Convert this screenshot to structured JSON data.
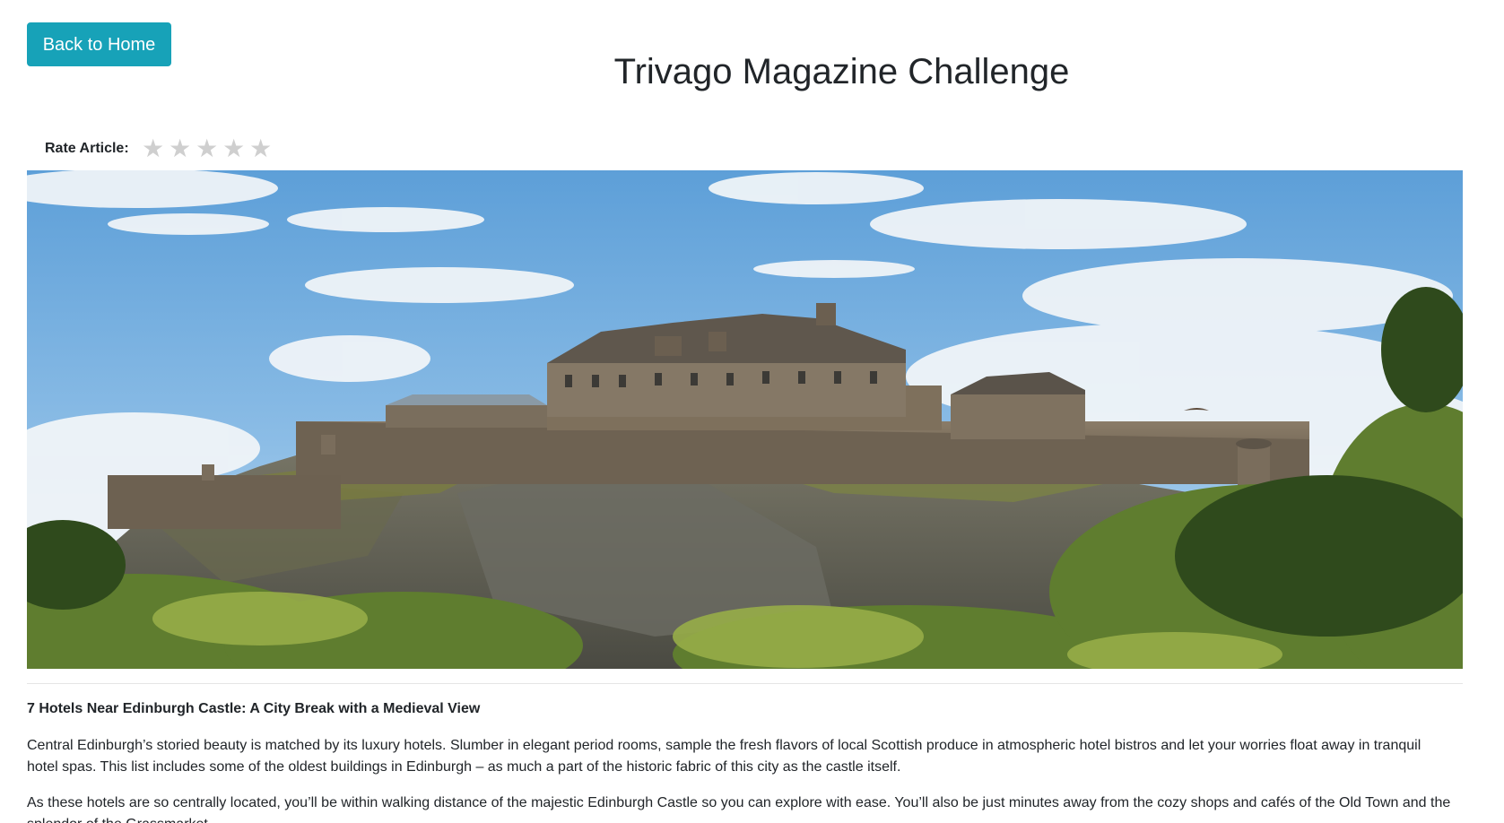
{
  "nav": {
    "back_label": "Back to Home"
  },
  "header": {
    "title": "Trivago Magazine Challenge"
  },
  "rating": {
    "label": "Rate Article:",
    "stars": [
      "★",
      "★",
      "★",
      "★",
      "★"
    ],
    "selected": 0,
    "max": 5,
    "star_color": "#cfcfcf"
  },
  "hero": {
    "subject": "edinburgh-castle-photo"
  },
  "article": {
    "heading": "7 Hotels Near Edinburgh Castle: A City Break with a Medieval View",
    "paragraphs": [
      "Central Edinburgh’s storied beauty is matched by its luxury hotels. Slumber in elegant period rooms, sample the fresh flavors of local Scottish produce in atmospheric hotel bistros and let your worries float away in tranquil hotel spas. This list includes some of the oldest buildings in Edinburgh – as much a part of the historic fabric of this city as the castle itself.",
      "As these hotels are so centrally located, you’ll be within walking distance of the majestic Edinburgh Castle so you can explore with ease. You’ll also be just minutes away from the cozy shops and cafés of the Old Town and the splendor of the Grassmarket."
    ]
  },
  "colors": {
    "accent": "#17a2b8",
    "text": "#212529"
  }
}
